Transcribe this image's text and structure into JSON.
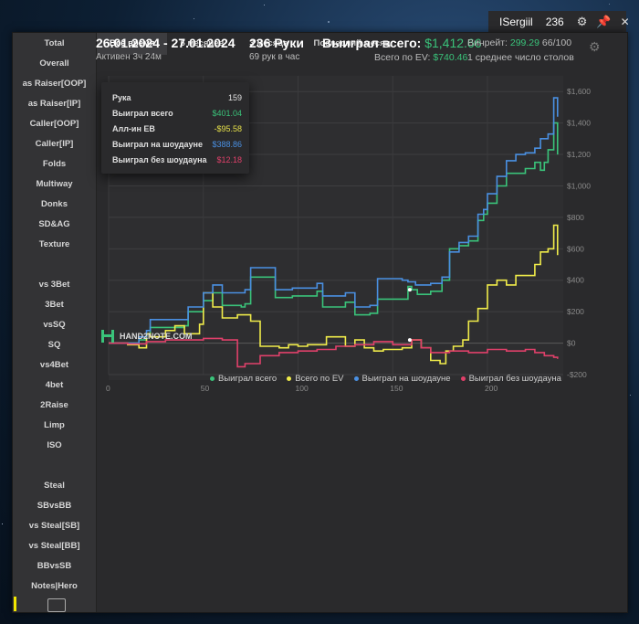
{
  "topbar": {
    "user": "ISergiil",
    "count": "236"
  },
  "sidebar": {
    "items": [
      "Total",
      "Overall",
      "as Raiser[OOP]",
      "as Raiser[IP]",
      "Caller[OOP]",
      "Caller[IP]",
      "Folds",
      "Multiway",
      "Donks",
      "SD&AG",
      "Texture",
      "",
      "vs 3Bet",
      "3Bet",
      "vsSQ",
      "SQ",
      "vs4Bet",
      "4bet",
      "2Raise",
      "Limp",
      "ISO",
      "",
      "Steal",
      "SBvsBB",
      "vs Steal[SB]",
      "vs Steal[BB]",
      "BBvsSB",
      "Notes|Hero"
    ]
  },
  "tabs": [
    "Все время",
    "6 месяцев",
    "3 месяца",
    "Последний месяц"
  ],
  "stats": {
    "dates": "26.01.2024 - 27.01.2024",
    "active": "Активен 3ч 24м",
    "hands": "236 Руки",
    "hands_rate": "69 рук в час",
    "won_label": "Выиграл всего:",
    "won_value": "$1,412.66",
    "ev_label": "Всего по EV:",
    "ev_value": "$740.46",
    "winrate_label": "Винрейт:",
    "winrate_value": "299.29",
    "winrate_unit": "66/100",
    "tables": "1 среднее число столов"
  },
  "tooltip": {
    "rows": [
      {
        "k": "Рука",
        "v": "159",
        "color": "#e0e0e0"
      },
      {
        "k": "Выиграл всего",
        "v": "$401.04",
        "color": "#3ac37a"
      },
      {
        "k": "Алл-ин ЕВ",
        "v": "-$95.58",
        "color": "#e6e04a"
      },
      {
        "k": "Выиграл на шоудауне",
        "v": "$388.86",
        "color": "#4a90e2"
      },
      {
        "k": "Выиграл без шоудауна",
        "v": "$12.18",
        "color": "#e0406a"
      }
    ]
  },
  "logo_text": "HAND2NOTE.COM",
  "colors": {
    "won": "#3ac37a",
    "ev": "#f0ec4a",
    "sd": "#4a90e2",
    "nsd": "#e0406a"
  },
  "chart_data": {
    "type": "line",
    "xlim": [
      0,
      240
    ],
    "ylim": [
      -200,
      1700
    ],
    "xticks": [
      0,
      50,
      100,
      150,
      200
    ],
    "yticks": [
      "-$200",
      "$0",
      "$200",
      "$400",
      "$600",
      "$800",
      "$1,000",
      "$1,200",
      "$1,400",
      "$1,600"
    ],
    "series": [
      {
        "name": "Выиграл всего",
        "color": "#3ac37a",
        "points": [
          [
            0,
            0
          ],
          [
            10,
            0
          ],
          [
            16,
            20
          ],
          [
            20,
            60
          ],
          [
            22,
            100
          ],
          [
            40,
            110
          ],
          [
            42,
            200
          ],
          [
            48,
            200
          ],
          [
            50,
            270
          ],
          [
            55,
            320
          ],
          [
            60,
            240
          ],
          [
            70,
            230
          ],
          [
            72,
            250
          ],
          [
            75,
            420
          ],
          [
            85,
            420
          ],
          [
            88,
            290
          ],
          [
            95,
            290
          ],
          [
            97,
            300
          ],
          [
            105,
            300
          ],
          [
            110,
            330
          ],
          [
            113,
            230
          ],
          [
            120,
            230
          ],
          [
            125,
            260
          ],
          [
            130,
            180
          ],
          [
            138,
            190
          ],
          [
            142,
            280
          ],
          [
            155,
            280
          ],
          [
            158,
            360
          ],
          [
            160,
            340
          ],
          [
            163,
            310
          ],
          [
            170,
            330
          ],
          [
            176,
            400
          ],
          [
            180,
            600
          ],
          [
            185,
            620
          ],
          [
            190,
            650
          ],
          [
            195,
            780
          ],
          [
            198,
            820
          ],
          [
            200,
            890
          ],
          [
            205,
            1000
          ],
          [
            210,
            1080
          ],
          [
            215,
            1080
          ],
          [
            220,
            1110
          ],
          [
            225,
            1150
          ],
          [
            228,
            1100
          ],
          [
            230,
            1150
          ],
          [
            232,
            1230
          ],
          [
            235,
            1400
          ],
          [
            237,
            1200
          ]
        ]
      },
      {
        "name": "Всего по EV",
        "color": "#f0ec4a",
        "points": [
          [
            0,
            0
          ],
          [
            10,
            -10
          ],
          [
            16,
            -30
          ],
          [
            20,
            60
          ],
          [
            22,
            40
          ],
          [
            30,
            80
          ],
          [
            35,
            110
          ],
          [
            40,
            60
          ],
          [
            45,
            60
          ],
          [
            48,
            120
          ],
          [
            50,
            320
          ],
          [
            55,
            230
          ],
          [
            60,
            160
          ],
          [
            68,
            180
          ],
          [
            75,
            140
          ],
          [
            80,
            -20
          ],
          [
            90,
            -30
          ],
          [
            95,
            -10
          ],
          [
            100,
            -20
          ],
          [
            105,
            -10
          ],
          [
            115,
            40
          ],
          [
            125,
            -20
          ],
          [
            130,
            20
          ],
          [
            135,
            -30
          ],
          [
            140,
            -50
          ],
          [
            145,
            -40
          ],
          [
            150,
            -40
          ],
          [
            155,
            -30
          ],
          [
            160,
            20
          ],
          [
            165,
            -30
          ],
          [
            170,
            -110
          ],
          [
            175,
            -130
          ],
          [
            178,
            -50
          ],
          [
            182,
            -20
          ],
          [
            187,
            20
          ],
          [
            190,
            140
          ],
          [
            195,
            220
          ],
          [
            200,
            370
          ],
          [
            205,
            400
          ],
          [
            210,
            370
          ],
          [
            215,
            430
          ],
          [
            220,
            430
          ],
          [
            225,
            500
          ],
          [
            228,
            580
          ],
          [
            232,
            600
          ],
          [
            235,
            750
          ],
          [
            237,
            560
          ]
        ]
      },
      {
        "name": "Выиграл на шоудауне",
        "color": "#4a90e2",
        "points": [
          [
            0,
            0
          ],
          [
            10,
            0
          ],
          [
            16,
            40
          ],
          [
            20,
            80
          ],
          [
            22,
            150
          ],
          [
            40,
            150
          ],
          [
            42,
            230
          ],
          [
            48,
            230
          ],
          [
            50,
            320
          ],
          [
            55,
            370
          ],
          [
            60,
            320
          ],
          [
            70,
            320
          ],
          [
            72,
            340
          ],
          [
            75,
            480
          ],
          [
            85,
            480
          ],
          [
            88,
            340
          ],
          [
            95,
            340
          ],
          [
            97,
            350
          ],
          [
            105,
            350
          ],
          [
            110,
            380
          ],
          [
            113,
            300
          ],
          [
            120,
            300
          ],
          [
            125,
            320
          ],
          [
            130,
            230
          ],
          [
            138,
            240
          ],
          [
            142,
            410
          ],
          [
            150,
            410
          ],
          [
            155,
            400
          ],
          [
            158,
            390
          ],
          [
            162,
            370
          ],
          [
            170,
            380
          ],
          [
            176,
            420
          ],
          [
            180,
            580
          ],
          [
            185,
            640
          ],
          [
            190,
            680
          ],
          [
            195,
            820
          ],
          [
            198,
            850
          ],
          [
            200,
            950
          ],
          [
            205,
            1060
          ],
          [
            210,
            1160
          ],
          [
            215,
            1200
          ],
          [
            220,
            1210
          ],
          [
            225,
            1240
          ],
          [
            228,
            1300
          ],
          [
            232,
            1330
          ],
          [
            235,
            1560
          ],
          [
            237,
            1440
          ]
        ]
      },
      {
        "name": "Выиграл без шоудауна",
        "color": "#e0406a",
        "points": [
          [
            0,
            0
          ],
          [
            10,
            -5
          ],
          [
            20,
            10
          ],
          [
            30,
            20
          ],
          [
            40,
            20
          ],
          [
            50,
            30
          ],
          [
            60,
            20
          ],
          [
            68,
            -150
          ],
          [
            72,
            -130
          ],
          [
            80,
            -80
          ],
          [
            90,
            -60
          ],
          [
            100,
            -50
          ],
          [
            110,
            -40
          ],
          [
            120,
            -20
          ],
          [
            130,
            -10
          ],
          [
            140,
            10
          ],
          [
            150,
            -10
          ],
          [
            160,
            20
          ],
          [
            165,
            -30
          ],
          [
            170,
            -60
          ],
          [
            175,
            -60
          ],
          [
            180,
            -50
          ],
          [
            190,
            -60
          ],
          [
            200,
            -40
          ],
          [
            210,
            -50
          ],
          [
            220,
            -40
          ],
          [
            225,
            -60
          ],
          [
            230,
            -80
          ],
          [
            235,
            -90
          ],
          [
            237,
            -100
          ]
        ]
      }
    ]
  }
}
